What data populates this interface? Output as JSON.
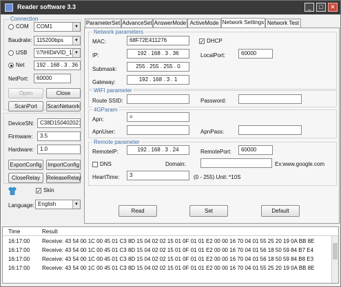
{
  "window": {
    "title": "Reader software 3.3",
    "min": "_",
    "max": "□",
    "close": "✕"
  },
  "connection": {
    "title": "Connection",
    "com_label": "COM",
    "com_value": "COM1",
    "baud_label": "Baudrate:",
    "baud_value": "115200bps",
    "usb_label": "USB",
    "usb_value": "\\\\?\\HID#VID_1A",
    "net_label": "Net",
    "net_value": "192 . 168 . 3 . 36",
    "netport_label": "NetPort:",
    "netport_value": "60000",
    "open_btn": "Open",
    "close_btn": "Close",
    "scanport_btn": "ScanPort",
    "scannetwork_btn": "ScanNetwork",
    "selected_mode": "Net"
  },
  "device": {
    "sn_label": "DeviceSN:",
    "sn_value": "C38D1504020215",
    "firmware_label": "Firmware:",
    "firmware_value": "3.5",
    "hardware_label": "Hardware:",
    "hardware_value": "1.0",
    "export_btn": "ExportConfig",
    "import_btn": "ImportConfig",
    "closerelay_btn": "CloseRelay",
    "releaserelay_btn": "ReleaseRelay",
    "skin_label": "Skin",
    "skin_checked": true,
    "language_label": "Language:",
    "language_value": "English"
  },
  "tabs": [
    {
      "label": "ParameterSet",
      "active": false
    },
    {
      "label": "AdvanceSet",
      "active": false
    },
    {
      "label": "AnswerMode",
      "active": false
    },
    {
      "label": "ActiveMode",
      "active": false
    },
    {
      "label": "Network Settings",
      "active": true
    },
    {
      "label": "Network Test",
      "active": false
    }
  ],
  "network": {
    "title": "Network parameters",
    "mac_label": "MAC:",
    "mac_value": "68F72E411276",
    "dhcp_label": "DHCP",
    "dhcp_checked": true,
    "ip_label": "IP:",
    "ip_value": "192 . 168 . 3 . 36",
    "localport_label": "LocalPort:",
    "localport_value": "60000",
    "submask_label": "Submask:",
    "submask_value": "255 . 255 . 255 . 0",
    "gateway_label": "Gateway:",
    "gateway_value": "192 . 168 . 3 . 1"
  },
  "wifi": {
    "title": "WIFI parameter",
    "ssid_label": "Route SSID:",
    "ssid_value": "",
    "password_label": "Password:",
    "password_value": ""
  },
  "fourg": {
    "title": "4GParam",
    "apn_label": "Apn:",
    "apn_value": "=",
    "apnuser_label": "ApnUser:",
    "apnuser_value": "",
    "apnpass_label": "ApnPass:",
    "apnpass_value": ""
  },
  "remote": {
    "title": "Remote parameter",
    "remoteip_label": "RemoteIP:",
    "remoteip_value": "192 . 168 . 3 . 24",
    "remoteport_label": "RemotePort:",
    "remoteport_value": "60000",
    "dns_label": "DNS",
    "dns_checked": false,
    "domain_label": "Domain:",
    "domain_value": "",
    "domain_hint": "Ex:www.google.com",
    "heartbeat_label": "HeartTime:",
    "heartbeat_value": "3",
    "heartbeat_hint": "(0 - 255) Unit: *10S"
  },
  "actions": {
    "read": "Read",
    "set": "Set",
    "default": "Default"
  },
  "log": {
    "col_time": "Time",
    "col_result": "Result",
    "rows": [
      {
        "time": "16:17:00",
        "result": "Receive: 43 54 00 1C 00 45 01 C3 8D 15 04 02 02 15 01 0F 01 01 E2 00 00 16 70 04 01 55 25 20 19 0A BB 8E"
      },
      {
        "time": "16:17:00",
        "result": "Receive: 43 54 00 1C 00 45 01 C3 8D 15 04 02 02 15 01 0F 01 01 E2 00 00 16 70 04 01 56 18 50 59 84 B7 E4"
      },
      {
        "time": "16:17:00",
        "result": "Receive: 43 54 00 1C 00 45 01 C3 8D 15 04 02 02 15 01 0F 01 01 E2 00 00 16 70 04 01 56 18 50 59 84 B8 E3"
      },
      {
        "time": "16:17:00",
        "result": "Receive: 43 54 00 1C 00 45 01 C3 8D 15 04 02 02 15 01 0F 01 01 E2 00 00 16 70 04 01 55 25 20 19 0A BB 8E"
      }
    ]
  }
}
